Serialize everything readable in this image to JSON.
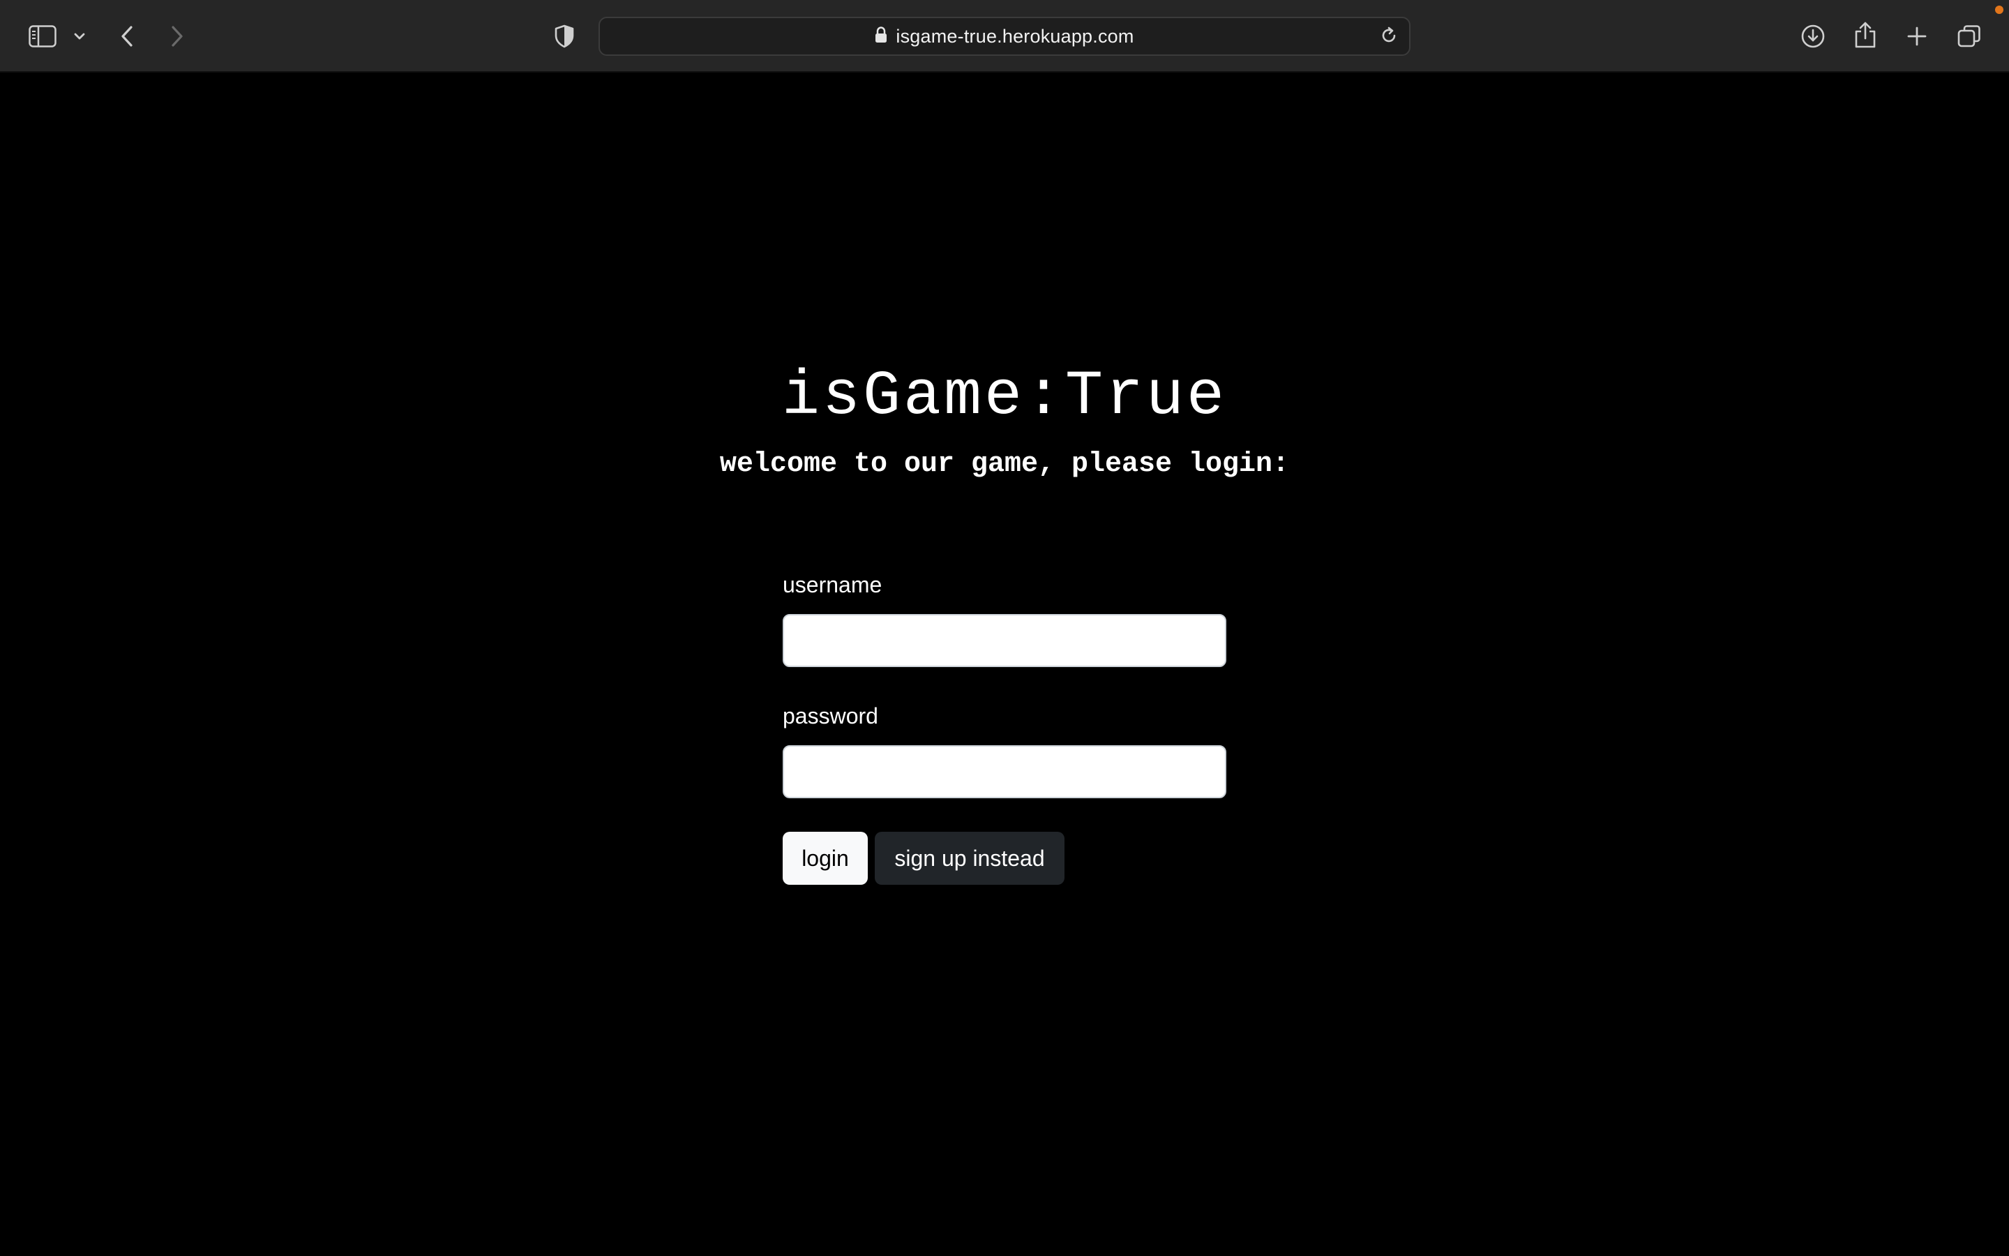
{
  "browser": {
    "url": "isgame-true.herokuapp.com",
    "icons": {
      "sidebar": "sidebar-icon",
      "sidebar_menu": "chevron-down-icon",
      "back": "back-arrow-icon",
      "forward": "forward-arrow-icon",
      "privacy": "shield-icon",
      "lock": "lock-icon",
      "reload": "reload-icon",
      "downloads": "download-icon",
      "share": "share-icon",
      "new_tab": "plus-icon",
      "tab_overview": "tabs-icon"
    },
    "notification_dot_color": "#e2761b"
  },
  "page": {
    "title": "isGame:True",
    "subtitle": "welcome to our game, please login:",
    "username": {
      "label": "username",
      "value": "",
      "placeholder": ""
    },
    "password": {
      "label": "password",
      "value": "",
      "placeholder": ""
    },
    "login_label": "login",
    "signup_label": "sign up instead"
  },
  "colors": {
    "background": "#000000",
    "toolbar": "#262626",
    "login_button": "#f8f9fa",
    "signup_button": "#212529"
  }
}
